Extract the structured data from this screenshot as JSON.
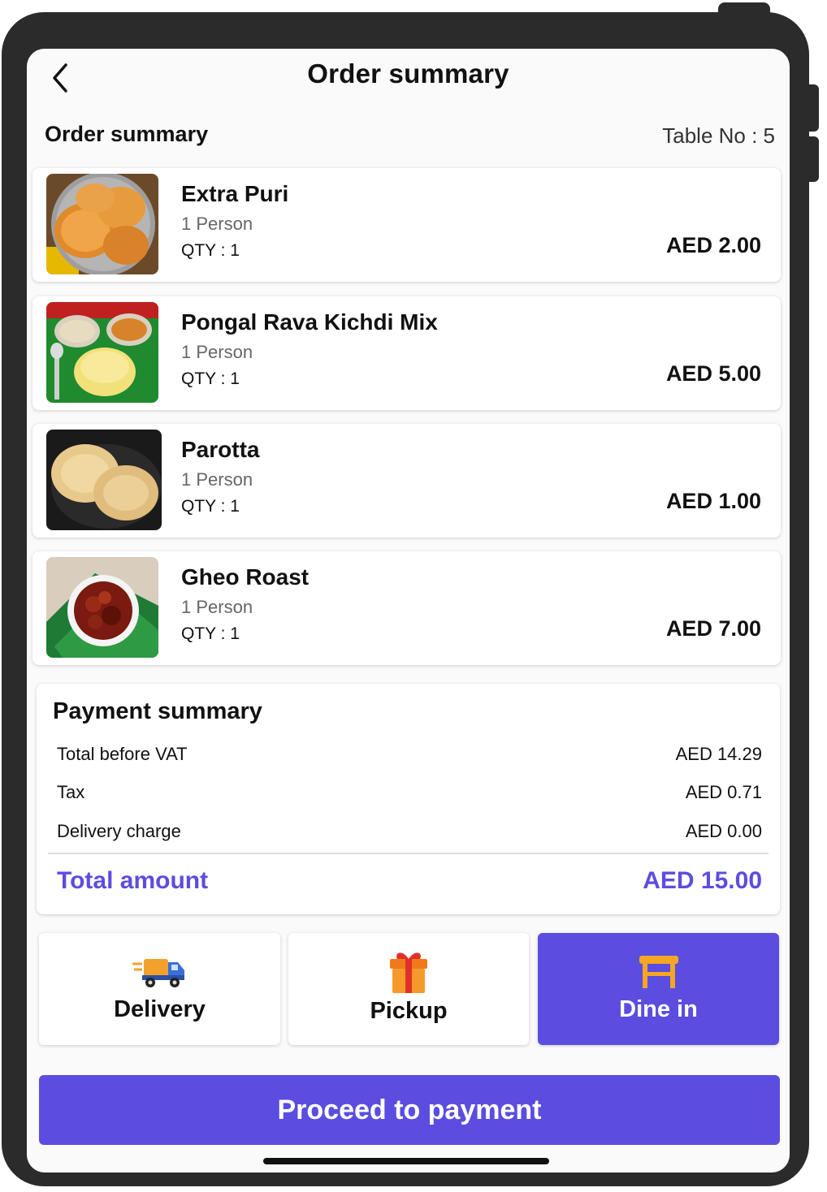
{
  "header": {
    "title": "Order summary",
    "back_icon": "chevron-left-icon"
  },
  "order": {
    "section_title": "Order summary",
    "table_no": "Table No : 5",
    "items": [
      {
        "name": "Extra Puri",
        "person": "1 Person",
        "qty": "QTY : 1",
        "price": "AED 2.00",
        "image": "extra-puri-image"
      },
      {
        "name": "Pongal Rava Kichdi Mix",
        "person": "1 Person",
        "qty": "QTY : 1",
        "price": "AED 5.00",
        "image": "pongal-image"
      },
      {
        "name": "Parotta",
        "person": "1 Person",
        "qty": "QTY : 1",
        "price": "AED 1.00",
        "image": "parotta-image"
      },
      {
        "name": "Gheo Roast",
        "person": "1 Person",
        "qty": "QTY : 1",
        "price": "AED 7.00",
        "image": "gheo-roast-image"
      }
    ]
  },
  "payment": {
    "title": "Payment summary",
    "rows": [
      {
        "label": "Total before VAT",
        "value": "AED 14.29"
      },
      {
        "label": "Tax",
        "value": "AED 0.71"
      },
      {
        "label": "Delivery charge",
        "value": "AED 0.00"
      }
    ],
    "total_label": "Total amount",
    "total_value": "AED 15.00"
  },
  "modes": {
    "delivery": {
      "label": "Delivery",
      "icon": "delivery-truck-icon"
    },
    "pickup": {
      "label": "Pickup",
      "icon": "gift-box-icon"
    },
    "dine_in": {
      "label": "Dine in",
      "icon": "table-icon",
      "selected": true
    }
  },
  "proceed_label": "Proceed to payment",
  "colors": {
    "accent": "#5b4de0",
    "frame": "#2b2b2b"
  }
}
